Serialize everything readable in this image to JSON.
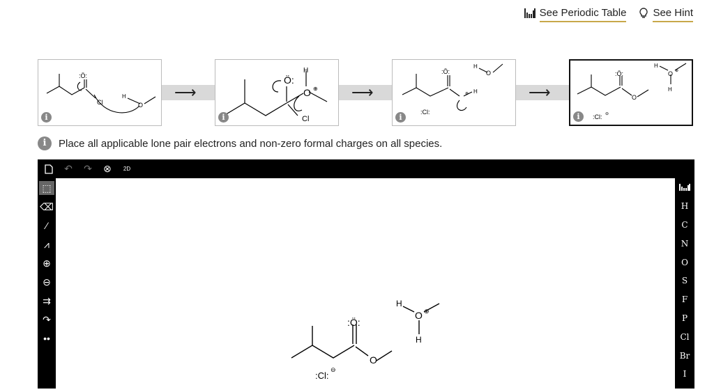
{
  "header": {
    "periodic_table_label": "See Periodic Table",
    "hint_label": "See Hint",
    "periodic_icon": "periodic-table-icon",
    "hint_icon": "lightbulb-icon"
  },
  "steps": [
    {
      "info": "i",
      "labels": {
        "o": ":Ö:",
        "cl": "Cl",
        "h": "H",
        "o2": "O"
      }
    },
    {
      "info": "i",
      "labels": {
        "o": "Ö:",
        "h": "H",
        "o2": "O",
        "charge": "⊕",
        "cl": "Cl"
      }
    },
    {
      "info": "i",
      "labels": {
        "o": ":Ö:",
        "h": "H",
        "o2": "O",
        "h2": "H",
        "cl": ":Cl:",
        "charge": "⊕"
      }
    },
    {
      "info": "i",
      "labels": {
        "o": ":Ö:",
        "h": "H",
        "o2": "O",
        "charge": "⊕",
        "h2": "H",
        "cl": ":Cl:",
        "charge2": "⊖",
        "o3": "O"
      }
    }
  ],
  "instruction": {
    "icon": "i",
    "text": "Place all applicable lone pair electrons and non-zero formal charges on all species."
  },
  "editor": {
    "top_tools": [
      "new-document-icon",
      "undo-icon",
      "redo-icon",
      "clear-icon",
      "2d-icon"
    ],
    "top_label_2d": "2D",
    "left_tools": [
      "select-icon",
      "eraser-icon",
      "bond-icon",
      "chain-icon",
      "plus-charge-icon",
      "minus-charge-icon",
      "arrow-tool-icon",
      "curved-arrow-icon",
      "lone-pair-icon"
    ],
    "right_atoms": [
      "H",
      "C",
      "N",
      "O",
      "S",
      "F",
      "P",
      "Cl",
      "Br",
      "I"
    ],
    "periodic_icon": "periodic-table-icon",
    "canvas_labels": {
      "carbonyl_o": ":Ö:",
      "ester_o": "O",
      "cl": ":Cl:",
      "cl_charge": "⊖",
      "h3o_h1": "H",
      "h3o_o": "O",
      "h3o_charge": "⊕",
      "h3o_h2": "H"
    },
    "colors": {
      "toolbar": "#000000",
      "canvas": "#ffffff"
    }
  }
}
